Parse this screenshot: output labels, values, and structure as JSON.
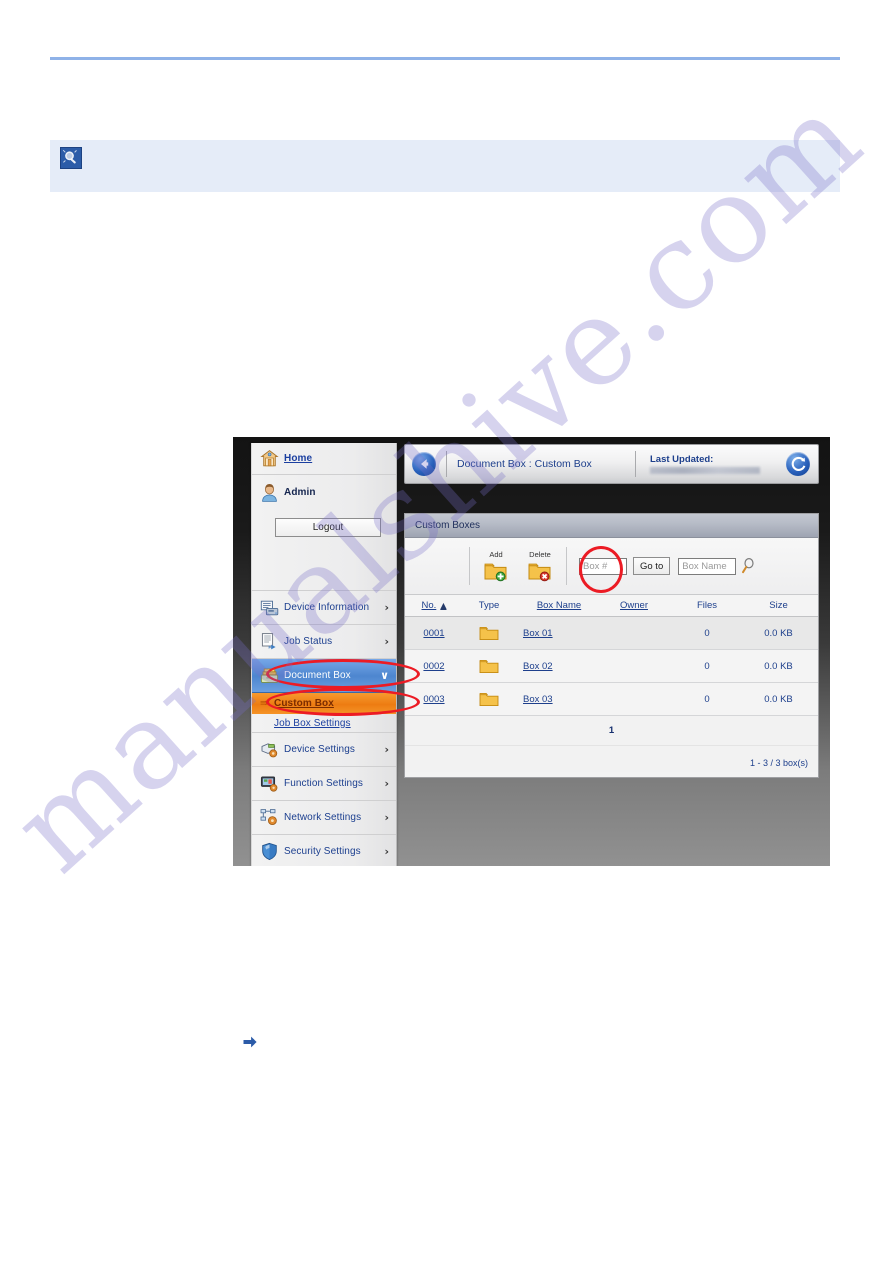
{
  "page": {
    "note": {
      "icon": "note-magnifier-icon",
      "text": ""
    },
    "step_arrow_icon": "right-arrow-icon",
    "watermark": "manualshive.com",
    "rule_color": "#8fb2e8"
  },
  "screenshot": {
    "sidebar": {
      "home": {
        "label": "Home",
        "icon": "home-icon"
      },
      "user": {
        "label": "Admin",
        "icon": "user-avatar-icon"
      },
      "logout_label": "Logout",
      "items": [
        {
          "label": "Device Information",
          "icon": "device-information-icon",
          "chevron": "›",
          "state": "normal"
        },
        {
          "label": "Job Status",
          "icon": "job-status-icon",
          "chevron": "›",
          "state": "normal"
        },
        {
          "label": "Document Box",
          "icon": "document-box-icon",
          "chevron": "∨",
          "state": "expanded-selected"
        },
        {
          "label": "Custom Box",
          "icon": "sub-item-bullet-icon",
          "state": "active-sub"
        },
        {
          "label": "Job Box Settings",
          "state": "sub"
        },
        {
          "label": "Device Settings",
          "icon": "device-settings-icon",
          "chevron": "›",
          "state": "normal"
        },
        {
          "label": "Function Settings",
          "icon": "function-settings-icon",
          "chevron": "›",
          "state": "normal"
        },
        {
          "label": "Network Settings",
          "icon": "network-settings-icon",
          "chevron": "›",
          "state": "normal"
        },
        {
          "label": "Security Settings",
          "icon": "security-settings-icon",
          "chevron": "›",
          "state": "normal"
        }
      ]
    },
    "topbar": {
      "back_icon": "back-arrow-icon",
      "breadcrumb": "Document Box : Custom Box",
      "last_updated_label": "Last Updated:",
      "last_updated_value": "",
      "refresh_icon": "refresh-icon"
    },
    "panel": {
      "title": "Custom Boxes",
      "toolbar": {
        "add_label": "Add",
        "add_icon": "folder-add-icon",
        "delete_label": "Delete",
        "delete_icon": "folder-delete-icon",
        "box_number_placeholder": "Box #",
        "box_number_value": "",
        "goto_label": "Go to",
        "box_name_placeholder": "Box Name",
        "box_name_value": "",
        "search_icon": "search-magnifier-icon"
      },
      "table": {
        "columns": [
          {
            "key": "no",
            "label": "No.",
            "sortable": true,
            "sorted": "asc"
          },
          {
            "key": "type",
            "label": "Type",
            "sortable": false
          },
          {
            "key": "name",
            "label": "Box Name",
            "sortable": true
          },
          {
            "key": "owner",
            "label": "Owner",
            "sortable": true
          },
          {
            "key": "files",
            "label": "Files",
            "sortable": false
          },
          {
            "key": "size",
            "label": "Size",
            "sortable": false
          }
        ],
        "sort_arrow": "▲",
        "rows": [
          {
            "no": "0001",
            "type_icon": "folder-icon",
            "name": "Box 01",
            "owner": "",
            "files": "0",
            "size": "0.0 KB"
          },
          {
            "no": "0002",
            "type_icon": "folder-icon",
            "name": "Box 02",
            "owner": "",
            "files": "0",
            "size": "0.0 KB"
          },
          {
            "no": "0003",
            "type_icon": "folder-icon",
            "name": "Box 03",
            "owner": "",
            "files": "0",
            "size": "0.0 KB"
          }
        ],
        "current_page": "1",
        "count_text": "1 - 3 / 3 box(s)"
      }
    },
    "annotations": [
      {
        "name": "annotation-ellipse-document-box",
        "color": "#ec1b24"
      },
      {
        "name": "annotation-ellipse-custom-box",
        "color": "#ec1b24"
      },
      {
        "name": "annotation-ellipse-add-button",
        "color": "#ec1b24"
      }
    ]
  }
}
